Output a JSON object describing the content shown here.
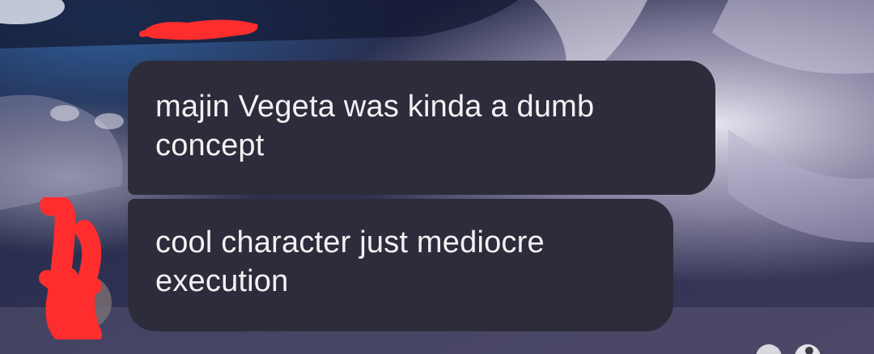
{
  "conversation": {
    "sender_name": "",
    "messages": [
      {
        "text": "majin Vegeta was kinda a dumb concept"
      },
      {
        "text": "cool character just mediocre execution"
      }
    ]
  },
  "icons": {
    "sender_avatar": "avatar-icon",
    "name_redaction": "red-scribble",
    "avatar_redaction": "red-scribble"
  },
  "colors": {
    "bubble_background": "#2d2c3b",
    "bubble_text": "#f2f2f4",
    "redaction": "#ff2d2d",
    "wallpaper_dark": "#1a1f3a",
    "wallpaper_light": "#d8d4e8"
  }
}
